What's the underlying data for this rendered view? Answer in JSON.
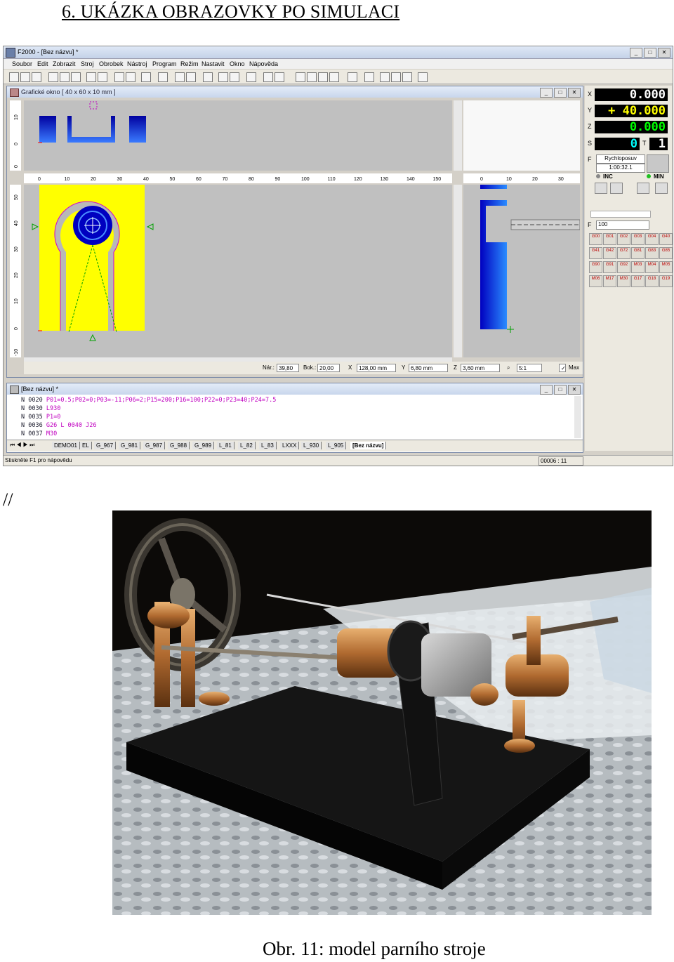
{
  "heading": "6. UKÁZKA OBRAZOVKY PO SIMULACI",
  "separator": "//",
  "caption": "Obr. 11: model parního stroje",
  "app": {
    "title": "F2000 - [Bez názvu] *",
    "menu": [
      "Soubor",
      "Edit",
      "Zobrazit",
      "Stroj",
      "Obrobek",
      "Nástroj",
      "Program",
      "Režim",
      "Nastavit",
      "Okno",
      "Nápověda"
    ],
    "graphics_window": {
      "title": "Grafické okno [ 40 x 60 x 10 mm ]",
      "x_ruler_ticks": [
        "0",
        "10",
        "20",
        "30",
        "40",
        "50",
        "60",
        "70",
        "80",
        "90",
        "100",
        "110",
        "120",
        "130",
        "140",
        "150"
      ],
      "side_ruler_ticks": [
        "0",
        "10",
        "20",
        "30"
      ],
      "y_ruler_ticks": [
        "50",
        "40",
        "30",
        "20",
        "10",
        "0",
        "-10"
      ],
      "top_ruler_ticks": [
        "10",
        "0",
        "0"
      ],
      "status": {
        "nar_label": "Nár.:",
        "nar_value": "39,80",
        "bok_label": "Bok.:",
        "bok_value": "20,00",
        "x_label": "X",
        "x_value": "128,00 mm",
        "y_label": "Y",
        "y_value": "6,80 mm",
        "z_label": "Z",
        "z_value": "3,60 mm",
        "zoom_value": "5:1",
        "max_label": "Max"
      }
    },
    "axes": [
      {
        "label": "X",
        "value": "0.000",
        "color": "#ffffff"
      },
      {
        "label": "Y",
        "value": "+ 40.000",
        "color": "#ffff00"
      },
      {
        "label": "Z",
        "value": "0.000",
        "color": "#00ff00"
      }
    ],
    "spindle": {
      "s_label": "S",
      "s_value": "0",
      "t_label": "T",
      "t_value": "1"
    },
    "feed": {
      "label": "F",
      "mode": "Rychloposuv",
      "time": "1:00:32.1"
    },
    "modes": {
      "inc": "INC",
      "min": "MIN"
    },
    "feed_input": {
      "label": "F",
      "value": "100"
    },
    "gcode_buttons": [
      "G00",
      "G01",
      "G02",
      "G03",
      "G04",
      "G40",
      "G41",
      "G42",
      "G72",
      "G81",
      "G83",
      "G85",
      "G90",
      "G91",
      "G92",
      "M03",
      "M04",
      "M05",
      "M06",
      "M17",
      "M30",
      "G17",
      "G18",
      "G19"
    ],
    "editor": {
      "title": "[Bez názvu] *",
      "lines": [
        {
          "n": "N 0020",
          "rest": "P01=0.5;P02=0;P03=-11;P06=2;P15=200;P16=100;P22=0;P23=40;P24=7.5"
        },
        {
          "n": "N 0030",
          "rest": "L930"
        },
        {
          "n": "N 0035",
          "rest": "P1=0"
        },
        {
          "n": "N 0036",
          "rest": "G26 L 0040 J26"
        },
        {
          "n": "N 0037",
          "rest": "M30"
        }
      ],
      "tabs": [
        "DEMO01",
        "EL",
        "G_967",
        "G_981",
        "G_987",
        "G_988",
        "G_989",
        "L_81",
        "L_82",
        "L_83",
        "LXXX",
        "L_930",
        "L_905",
        "[Bez názvu]"
      ]
    },
    "statusbar": {
      "hint": "Stiskněte F1 pro nápovědu",
      "position": "00006 : 11"
    }
  }
}
